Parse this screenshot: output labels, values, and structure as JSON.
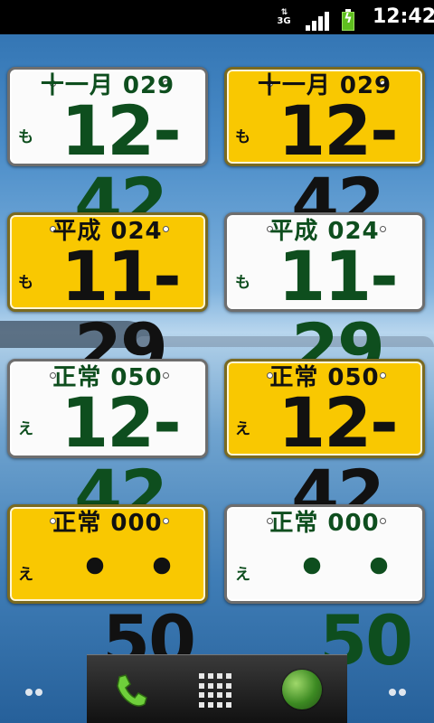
{
  "statusbar": {
    "network": "3G",
    "time": "12:42"
  },
  "plates": [
    {
      "style": "white",
      "top": "十一月 029",
      "kana": "も",
      "number": "12-42"
    },
    {
      "style": "yellow",
      "top": "十一月 029",
      "kana": "も",
      "number": "12-42"
    },
    {
      "style": "yellow",
      "top": "平成 024",
      "kana": "も",
      "number": "11-29"
    },
    {
      "style": "white",
      "top": "平成 024",
      "kana": "も",
      "number": "11-29"
    },
    {
      "style": "white",
      "top": "正常 050",
      "kana": "え",
      "number": "12-42"
    },
    {
      "style": "yellow",
      "top": "正常 050",
      "kana": "え",
      "number": "12-42"
    },
    {
      "style": "yellow",
      "top": "正常 000",
      "kana": "え",
      "number": "・・ 50"
    },
    {
      "style": "white",
      "top": "正常 000",
      "kana": "え",
      "number": "・・ 50"
    }
  ],
  "dock": {
    "phone_icon": "phone-icon",
    "apps_icon": "app-drawer-icon",
    "browser_icon": "globe-icon"
  },
  "colors": {
    "plate_white": "#fbfbfb",
    "plate_yellow": "#f9c801",
    "plate_green_text": "#0e4e1e"
  }
}
